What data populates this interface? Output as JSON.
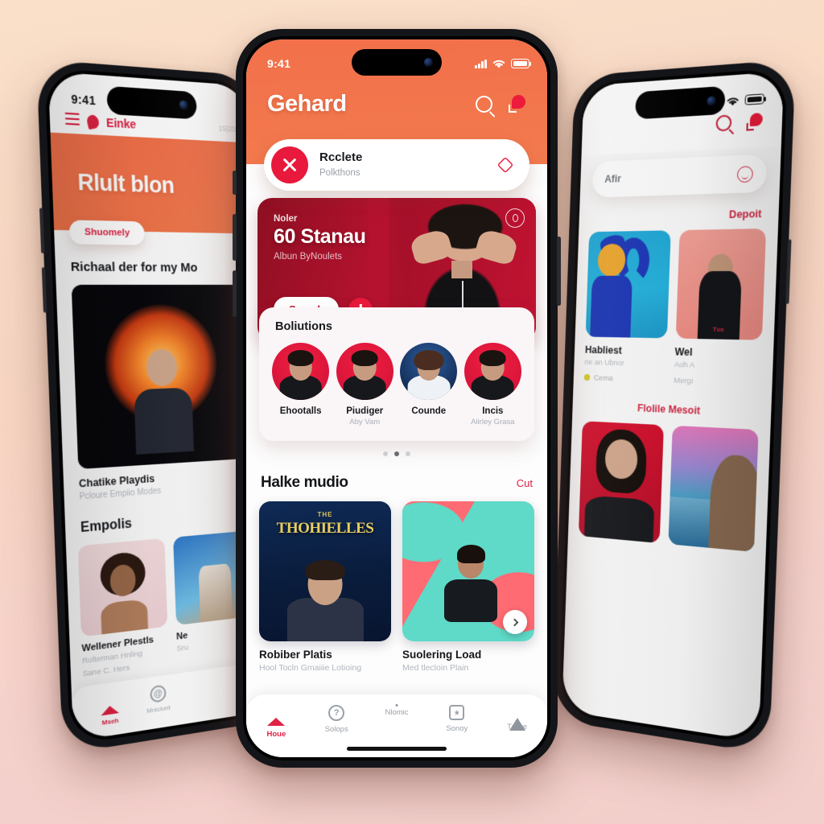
{
  "scene": {
    "background_top": "#FAE0C9",
    "background_bottom": "#F3CFCB",
    "accent_orange": "#F2704A",
    "accent_red": "#E02244",
    "deep_red": "#B3122E"
  },
  "center_phone": {
    "status_bar": {
      "time": "9:41",
      "signal_icon": "cellular-bars-icon",
      "wifi_icon": "wifi-icon",
      "battery_icon": "battery-icon"
    },
    "header": {
      "title": "Gehard",
      "search_icon": "search-icon",
      "notification_icon": "notification-bell-icon"
    },
    "pill_card": {
      "avatar_icon": "close-x-avatar-icon",
      "title": "Rcclete",
      "subtitle": "Polkthons",
      "trailing_icon": "sparkle-icon"
    },
    "hero": {
      "eyebrow": "Noler",
      "title": "60 Stanau",
      "subtitle": "Albun ByNoulets",
      "primary_button": "Search",
      "download_icon": "download-arrow-icon",
      "badge_icon": "record-badge-icon"
    },
    "people": {
      "heading": "Boliutions",
      "items": [
        {
          "name": "Ehootalls",
          "sub": "",
          "avatar_style": "red"
        },
        {
          "name": "Piudiger",
          "sub": "Aby Vam",
          "avatar_style": "red"
        },
        {
          "name": "Counde",
          "sub": "",
          "avatar_style": "blue"
        },
        {
          "name": "Incis",
          "sub": "Alirley Grasa",
          "avatar_style": "red"
        }
      ],
      "pager": {
        "count": 3,
        "active_index": 1
      }
    },
    "media_section": {
      "title": "Halke mudio",
      "link": "Cut",
      "cards": [
        {
          "art_the": "THE",
          "art_title": "THOHIELLES",
          "title": "Robiber Platis",
          "subtitle": "Hool Tocln Gmaiiie Lotioing"
        },
        {
          "art_the": "",
          "art_title": "",
          "title": "Suolering Load",
          "subtitle": "Med tlecloin Plain",
          "next_icon": "chevron-right-icon"
        }
      ]
    },
    "tabbar": [
      {
        "label": "Houe",
        "icon": "home-icon",
        "active": true
      },
      {
        "label": "Solops",
        "icon": "help-circle-icon",
        "active": false
      },
      {
        "label": "Nlomic",
        "icon": "shield-icon",
        "active": false
      },
      {
        "label": "Sonoy",
        "icon": "snowflake-box-icon",
        "active": false
      },
      {
        "label": "Tnore",
        "icon": "triangle-icon",
        "active": false
      }
    ]
  },
  "left_phone": {
    "status_bar": {
      "time": "9:41"
    },
    "header": {
      "menu_icon": "hamburger-menu-icon",
      "logo_icon": "heart-logo-icon",
      "brand": "Einke",
      "meta": "15|25"
    },
    "banner": {
      "title": "Rlult blon",
      "chip": "Shuomely"
    },
    "section_one": {
      "title": "Richaal der for my Mo"
    },
    "featured_tile": {
      "title": "Chatike Playdis",
      "subtitle": "Pcloure Empiio Modes"
    },
    "section_two": {
      "title": "Empolis"
    },
    "grid": [
      {
        "title": "Wellener Plestls",
        "line1": "Rolterman Hnling",
        "line2": "Sane C. Hers"
      },
      {
        "title": "Ne",
        "line1": "Sru",
        "line2": ""
      }
    ],
    "tabbar": [
      {
        "label": "Mseh",
        "icon": "home-icon",
        "active": true
      },
      {
        "label": "Mniciont",
        "icon": "at-circle-icon",
        "active": false
      }
    ]
  },
  "right_phone": {
    "status_bar": {
      "signal_icon": "cellular-bars-icon",
      "wifi_icon": "wifi-icon",
      "battery_icon": "battery-icon"
    },
    "header": {
      "search_icon": "search-icon",
      "notification_icon": "notification-bell-icon"
    },
    "search": {
      "value": "Afir",
      "smile_icon": "smiley-icon"
    },
    "link_top": "Depoit",
    "cards": [
      {
        "title": "Habliest",
        "subtitle": "ne an Ubnor",
        "chip": "Cema"
      },
      {
        "title": "Wel",
        "subtitle": "Aoh A",
        "meta": "Mergi"
      }
    ],
    "link_mid": "Flolile Mesoit"
  }
}
